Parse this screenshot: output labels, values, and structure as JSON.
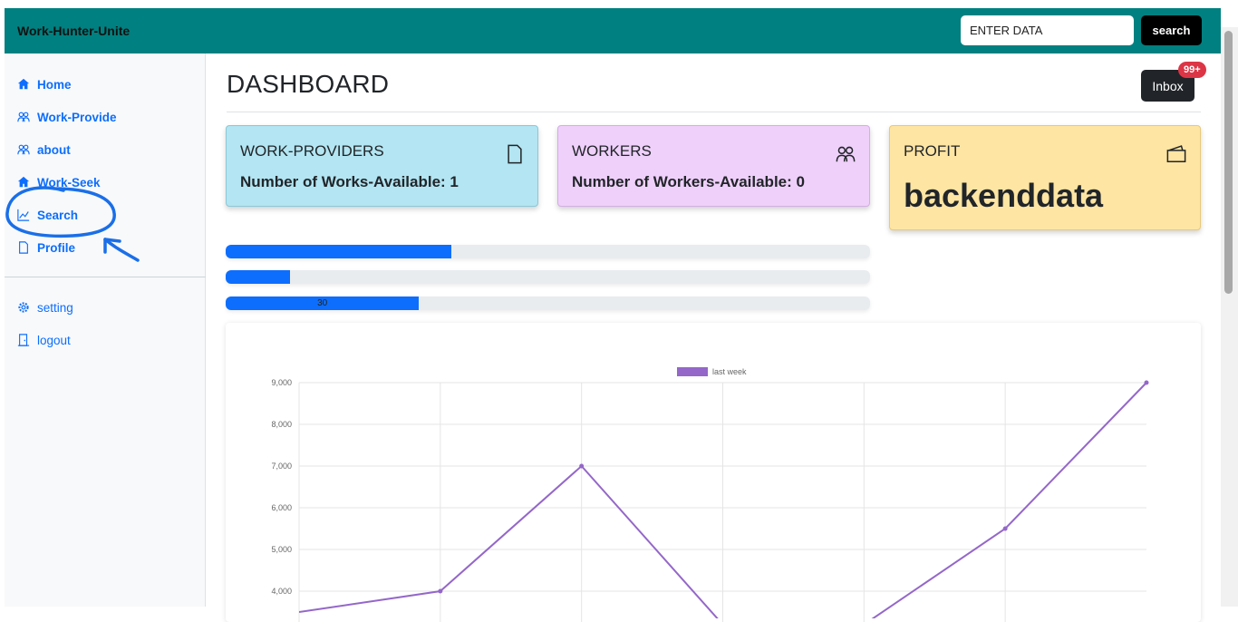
{
  "navbar": {
    "brand": "Work-Hunter-Unite",
    "search_value": "ENTER DATA",
    "search_button": "search",
    "color": "#008080"
  },
  "sidebar": {
    "items": [
      {
        "label": "Home",
        "icon": "house-icon"
      },
      {
        "label": "Work-Provide",
        "icon": "people-icon"
      },
      {
        "label": "about",
        "icon": "people-icon"
      },
      {
        "label": "Work-Seek",
        "icon": "house-icon"
      },
      {
        "label": "Search",
        "icon": "graph-up-icon"
      },
      {
        "label": "Profile",
        "icon": "file-icon"
      }
    ],
    "bottom_items": [
      {
        "label": "setting",
        "icon": "gear-icon"
      },
      {
        "label": "logout",
        "icon": "door-icon"
      }
    ]
  },
  "main": {
    "title": "DASHBOARD",
    "inbox_label": "Inbox",
    "inbox_badge": "99+",
    "cards": [
      {
        "title": "WORK-PROVIDERS",
        "value": "Number of Works-Available: 1",
        "icon": "file-icon",
        "color": "#b3e5f2"
      },
      {
        "title": "WORKERS",
        "value": "Number of Workers-Available: 0",
        "icon": "people-icon",
        "color": "#efd0fa"
      },
      {
        "title": "PROFIT",
        "value": "backenddata",
        "icon": "wallet-icon",
        "color": "#ffe5a3"
      }
    ],
    "progress": [
      {
        "percent": 35,
        "label": ""
      },
      {
        "percent": 10,
        "label": ""
      },
      {
        "percent": 30,
        "label": "30"
      }
    ]
  },
  "chart_data": {
    "type": "line",
    "series": [
      {
        "name": "last week",
        "color": "#9467c9",
        "values": [
          3500,
          4000,
          7000,
          3200,
          3200,
          5500,
          9000
        ]
      }
    ],
    "x_index": [
      0,
      1,
      2,
      3,
      4,
      5,
      6
    ],
    "y_ticks": [
      "9,000",
      "8,000",
      "7,000",
      "6,000",
      "5,000",
      "4,000"
    ],
    "ylim": [
      3700,
      9000
    ],
    "grid": true,
    "legend": "top-center"
  }
}
